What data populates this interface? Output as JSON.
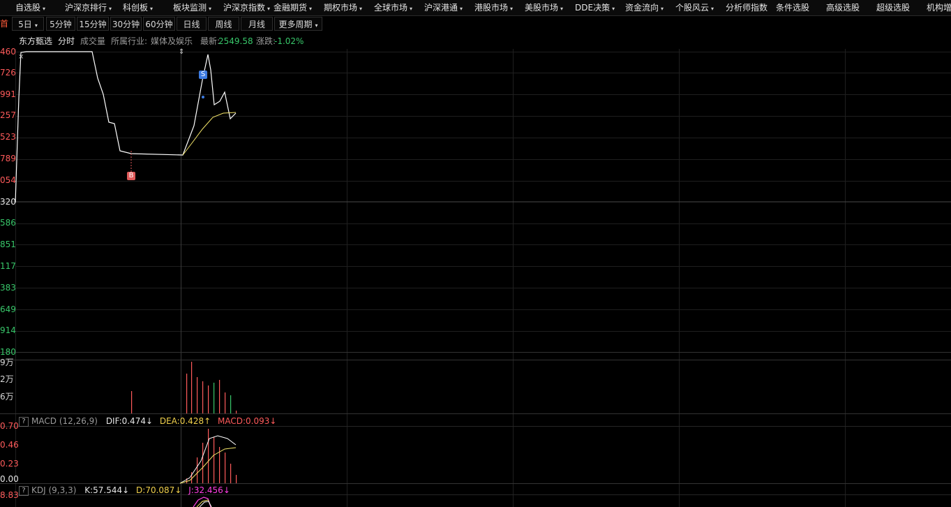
{
  "menu": {
    "items": [
      {
        "label": "自选股",
        "caret": true
      },
      {
        "label": "沪深京排行",
        "caret": true
      },
      {
        "label": "科创板",
        "caret": true
      },
      {
        "label": "板块监测",
        "caret": true
      },
      {
        "label": "沪深京指数",
        "caret": true
      },
      {
        "label": "金融期货",
        "caret": true
      },
      {
        "label": "期权市场",
        "caret": true
      },
      {
        "label": "全球市场",
        "caret": true
      },
      {
        "label": "沪深港通",
        "caret": true
      },
      {
        "label": "港股市场",
        "caret": true
      },
      {
        "label": "美股市场",
        "caret": true
      },
      {
        "label": "DDE决策",
        "caret": true
      },
      {
        "label": "资金流向",
        "caret": true
      },
      {
        "label": "个股风云",
        "caret": true
      },
      {
        "label": "分析师指数",
        "caret": false
      },
      {
        "label": "条件选股",
        "caret": false
      },
      {
        "label": "高级选股",
        "caret": false
      },
      {
        "label": "超级选股",
        "caret": false
      },
      {
        "label": "机构增",
        "caret": false
      }
    ]
  },
  "tabs": {
    "lead": "首",
    "items": [
      {
        "label": "5日",
        "caret": true
      },
      {
        "label": "5分钟",
        "caret": false
      },
      {
        "label": "15分钟",
        "caret": false
      },
      {
        "label": "30分钟",
        "caret": false
      },
      {
        "label": "60分钟",
        "caret": false
      },
      {
        "label": "日线",
        "caret": false
      },
      {
        "label": "周线",
        "caret": false
      },
      {
        "label": "月线",
        "caret": false
      },
      {
        "label": "更多周期",
        "caret": true
      }
    ]
  },
  "info": {
    "stock_name": "东方甄选",
    "view_label": "分时",
    "volume_label": "成交量",
    "industry_label": "所属行业:",
    "industry": "媒体及娱乐",
    "latest_label": "最新:",
    "latest": "2549.58",
    "change_label": "涨跌:",
    "change": "-1.02%"
  },
  "price_axis": {
    "labels": [
      "460",
      "726",
      "991",
      "257",
      "523",
      "789",
      "054",
      "320",
      "586",
      "851",
      "117",
      "383",
      "649",
      "914",
      "180"
    ],
    "colors": [
      "#ff5b5b",
      "#ff5b5b",
      "#ff5b5b",
      "#ff5b5b",
      "#ff5b5b",
      "#ff5b5b",
      "#ff5b5b",
      "#e6e6e6",
      "#38c76a",
      "#38c76a",
      "#38c76a",
      "#38c76a",
      "#38c76a",
      "#38c76a",
      "#38c76a"
    ]
  },
  "volume_axis": {
    "labels": [
      "9万",
      "2万",
      "6万"
    ]
  },
  "macd": {
    "title": "MACD",
    "params": "(12,26,9)",
    "dif_label": "DIF:",
    "dif": "0.474",
    "dif_arrow": "↓",
    "dea_label": "DEA:",
    "dea": "0.428",
    "dea_arrow": "↑",
    "macd_label": "MACD:",
    "macd": "0.093",
    "macd_arrow": "↓",
    "axis": [
      "0.70",
      "0.46",
      "0.23",
      "0.00"
    ]
  },
  "kdj": {
    "title": "KDJ",
    "params": "(9,3,3)",
    "k_label": "K:",
    "k": "57.544",
    "k_arrow": "↓",
    "d_label": "D:",
    "d": "70.087",
    "d_arrow": "↓",
    "j_label": "J:",
    "j": "32.456",
    "j_arrow": "↓",
    "axis": [
      "8.83"
    ]
  },
  "markers": {
    "buy": "B",
    "sell": "S"
  },
  "colors": {
    "price_line": "#ffffff",
    "avg_line": "#f5e66a",
    "up": "#ff5b5b",
    "down": "#38c76a",
    "grid": "#1f1f1f",
    "marker_buy": "#e05a5a",
    "marker_sell": "#3d7be0"
  }
}
